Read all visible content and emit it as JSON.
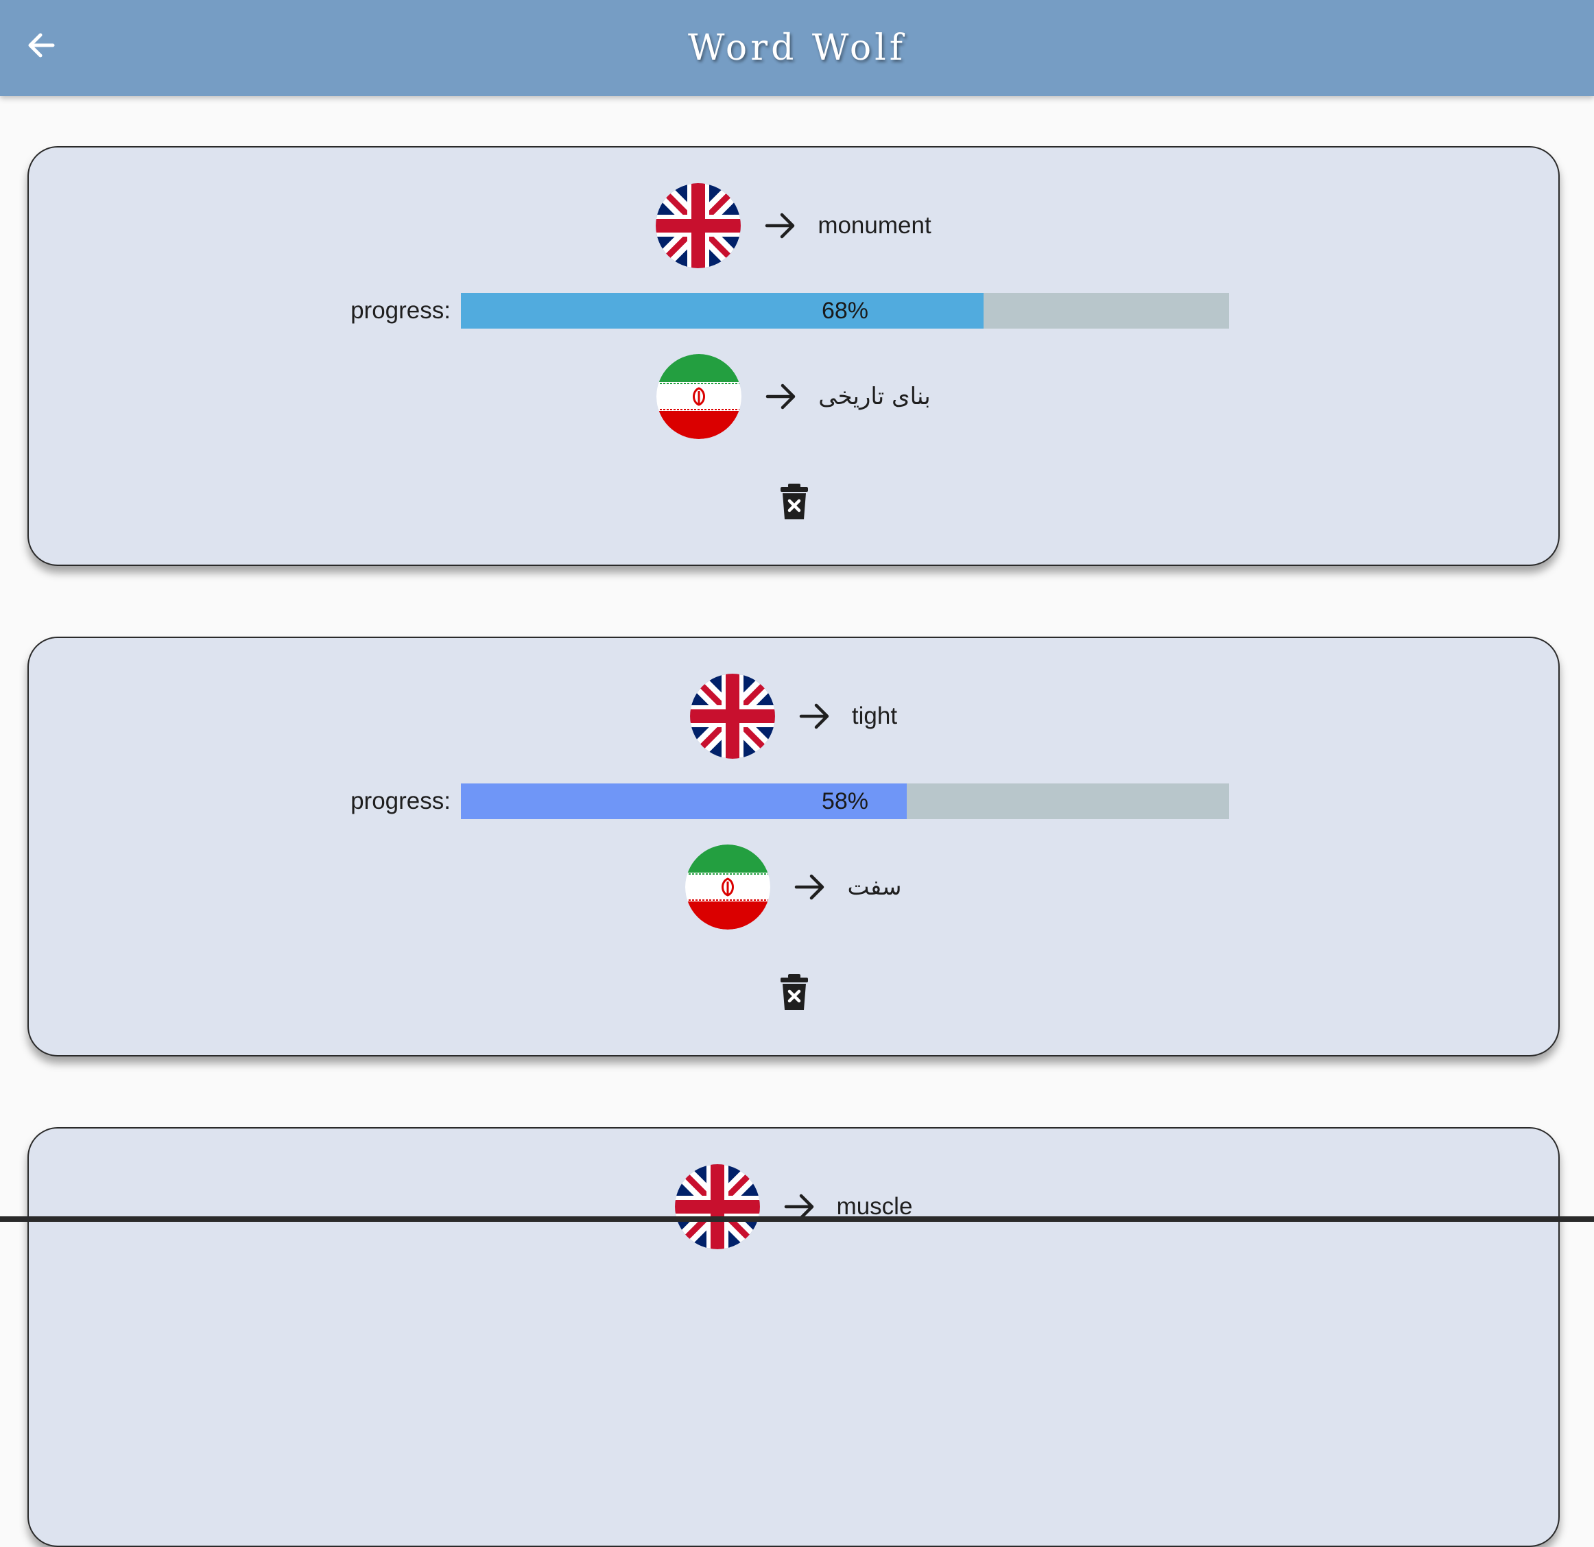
{
  "app": {
    "title": "Word Wolf",
    "back_icon": "arrow-left-icon",
    "appbar_color": "#769dc4",
    "card_color": "#dde3ef"
  },
  "cards": [
    {
      "source_flag": "uk-flag-icon",
      "source_word": "monument",
      "progress_label": "progress:",
      "progress_value": 68,
      "progress_text": "68%",
      "progress_color": "#51abde",
      "target_flag": "iran-flag-icon",
      "target_word": "بنای تاریخی",
      "delete_icon": "trash-x-icon"
    },
    {
      "source_flag": "uk-flag-icon",
      "source_word": "tight",
      "progress_label": "progress:",
      "progress_value": 58,
      "progress_text": "58%",
      "progress_color": "#6f96f7",
      "target_flag": "iran-flag-icon",
      "target_word": "سفت",
      "delete_icon": "trash-x-icon"
    },
    {
      "source_flag": "uk-flag-icon",
      "source_word": "muscle"
    }
  ]
}
